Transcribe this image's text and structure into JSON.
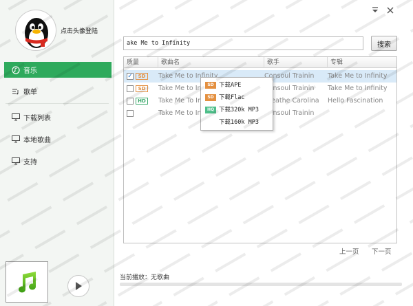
{
  "sidebar": {
    "login_text": "点击头像登陆",
    "nav": [
      {
        "label": "音乐",
        "icon": "music-icon",
        "active": true
      },
      {
        "label": "歌单",
        "icon": "playlist-icon",
        "active": false
      },
      {
        "label": "下载列表",
        "icon": "monitor-icon",
        "active": false
      },
      {
        "label": "本地歌曲",
        "icon": "monitor-icon",
        "active": false
      },
      {
        "label": "支持",
        "icon": "monitor-icon",
        "active": false
      }
    ]
  },
  "window": {
    "menu_icon": "▾",
    "close_icon": "✕"
  },
  "search": {
    "value": "ake Me to Infinity",
    "button_label": "搜索"
  },
  "table": {
    "headers": [
      "质量",
      "歌曲名",
      "歌手",
      "专辑"
    ],
    "rows": [
      {
        "checked": true,
        "quality": "SD",
        "song": "Take Me to Infinity",
        "artist": "Consoul Trainin",
        "album": "Take Me to Infinity",
        "selected": true
      },
      {
        "checked": false,
        "quality": "SD",
        "song": "Take Me to Inf",
        "artist": "Consoul Trainin",
        "album": "Take Me to Infinity",
        "selected": false
      },
      {
        "checked": false,
        "quality": "HD",
        "song": "Take Me To Inf",
        "artist": "Breathe Carolina",
        "album": "Hello Fascination",
        "selected": false
      },
      {
        "checked": false,
        "quality": "",
        "song": "Take Me to Inf",
        "artist": "Consoul Trainin",
        "album": "",
        "selected": false
      }
    ]
  },
  "context_menu": {
    "items": [
      {
        "badge": "SD",
        "label": "下载APE"
      },
      {
        "badge": "SD",
        "label": "下载Flac"
      },
      {
        "badge": "HQ",
        "label": "下载320k MP3"
      },
      {
        "badge": "",
        "label": "下载160k MP3"
      }
    ]
  },
  "pager": {
    "prev": "上一页",
    "next": "下一页"
  },
  "player": {
    "now_playing": "当前播放：无歌曲"
  },
  "colors": {
    "accent": "#2eaa5c",
    "selected_row": "#d9eaf8",
    "sd_badge": "#e49040",
    "hd_badge": "#3aa86a"
  }
}
